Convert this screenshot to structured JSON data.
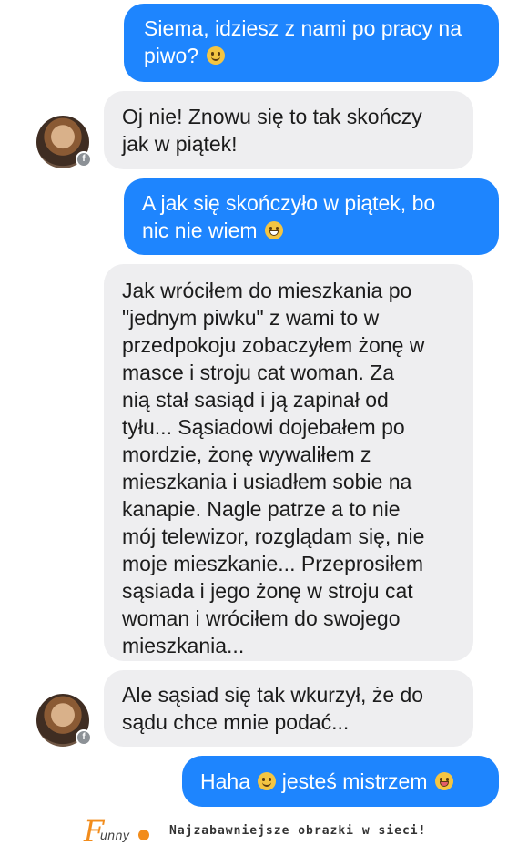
{
  "messages": [
    {
      "side": "out",
      "text": "Siema, idziesz z nami po pracy na\npiwo?",
      "emoji": "smile"
    },
    {
      "side": "in",
      "text": "Oj nie! Znowu się to tak skończy\njak w piątek!"
    },
    {
      "side": "out",
      "text": "A jak się skończyło w piątek, bo\nnic nie wiem",
      "emoji": "grin"
    },
    {
      "side": "in",
      "text": "Jak wróciłem do mieszkania po\n\"jednym piwku\" z wami to w\nprzedpokoju zobaczyłem żonę w\nmasce i stroju cat woman. Za\nnią stał sasiąd i ją zapinał od\ntyłu... Sąsiadowi dojebałem po\nmordzie, żonę wywaliłem z\nmieszkania i usiadłem sobie na\nkanapie. Nagle patrze a to nie\nmój telewizor, rozglądam się, nie\nmoje mieszkanie... Przeprosiłem\nsąsiada i jego żonę w stroju cat\nwoman i wróciłem do swojego\nmieszkania..."
    },
    {
      "side": "in",
      "text": "Ale sąsiad się tak wkurzył, że do\nsądu chce mnie podać..."
    },
    {
      "side": "out",
      "text": "Haha",
      "emoji": "smile",
      "text_after": "jesteś mistrzem",
      "emoji_after": "tongue"
    }
  ],
  "footer": {
    "logo_text": "unny",
    "slogan": "Najzabawniejsze obrazki w sieci!"
  },
  "colors": {
    "outgoing": "#1e85fe",
    "incoming": "#eeeef0",
    "logo": "#f28c1b"
  }
}
